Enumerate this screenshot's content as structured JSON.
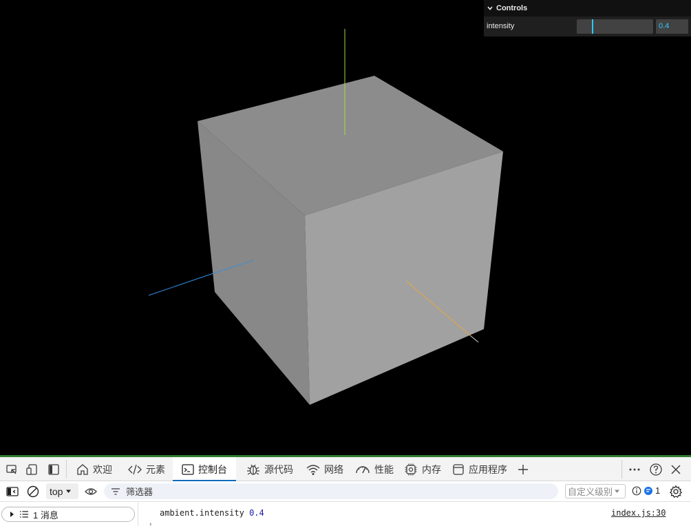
{
  "gui": {
    "title": "Controls",
    "param_label": "intensity",
    "value_text": "0.4",
    "slider_fraction": 0.2,
    "accent_color": "#2cc9ff"
  },
  "scene": {
    "background": "#000000",
    "cube_color": "#9a9a9a",
    "axis_colors": {
      "x": "#e6a93a",
      "y": "#9be03c",
      "z": "#2e8fe6"
    }
  },
  "devtools": {
    "tabs": [
      {
        "label": "欢迎",
        "icon": "home-icon"
      },
      {
        "label": "元素",
        "icon": "code-icon"
      },
      {
        "label": "控制台",
        "icon": "console-icon",
        "active": true
      },
      {
        "label": "源代码",
        "icon": "bug-icon"
      },
      {
        "label": "网络",
        "icon": "wifi-icon"
      },
      {
        "label": "性能",
        "icon": "gauge-icon"
      },
      {
        "label": "内存",
        "icon": "chip-icon"
      },
      {
        "label": "应用程序",
        "icon": "app-window-icon"
      }
    ],
    "context": "top",
    "filter_placeholder": "筛选器",
    "level": "自定义级别",
    "issues_count": "1",
    "message_group": "1 消息",
    "log": {
      "text": "ambient.intensity",
      "value": "0.4",
      "source": "index.js:30"
    }
  }
}
